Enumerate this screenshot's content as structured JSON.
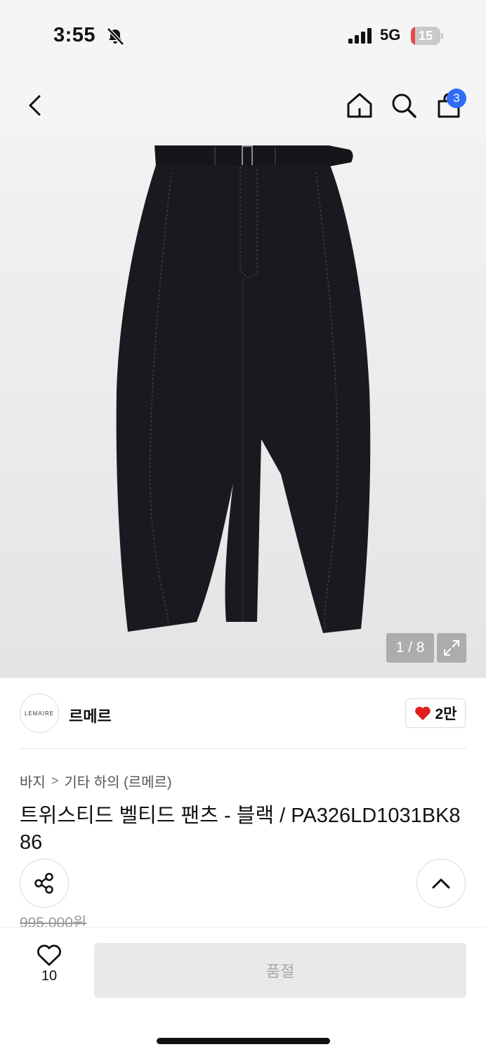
{
  "status_bar": {
    "time": "3:55",
    "network": "5G",
    "battery_level": "15",
    "battery_fraction": 0.15,
    "battery_color": "#e5484d",
    "icons": [
      "bell-slash-icon",
      "cellular-signal-icon",
      "battery-icon"
    ]
  },
  "nav": {
    "icons": [
      "chevron-left-icon",
      "home-icon",
      "search-icon",
      "shopping-bag-icon"
    ],
    "cart_count": "3",
    "badge_color": "#2f6df6"
  },
  "gallery": {
    "counter": "1 / 8",
    "expand_icon": "expand-icon",
    "image_subject": "black-pants-icon"
  },
  "brand": {
    "logo_text": "LEMAIRE",
    "name": "르메르",
    "like_icon": "heart-filled-icon",
    "like_count": "2만",
    "like_color": "#e02020"
  },
  "breadcrumb": {
    "items": [
      "바지",
      "기타 하의 (르메르)"
    ],
    "separator": ">"
  },
  "product": {
    "title": "트위스티드 벨티드 팬츠 - 블랙 / PA326LD1031BK886",
    "original_price": "995,000원"
  },
  "actions": {
    "share_icon": "share-icon",
    "scroll_top_icon": "chevron-up-icon"
  },
  "bottom_bar": {
    "wish_icon": "heart-outline-icon",
    "wish_count": "10",
    "soldout_label": "품절"
  }
}
